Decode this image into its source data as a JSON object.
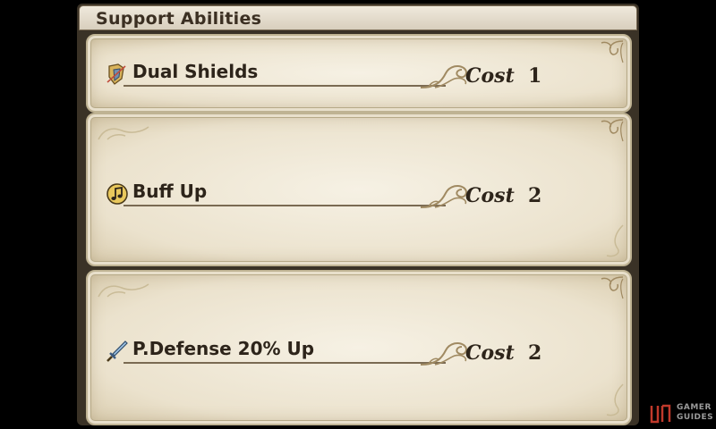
{
  "header": {
    "title": "Support Abilities"
  },
  "abilities": [
    {
      "name": "Dual Shields",
      "icon": "shield-icon",
      "cost_label": "Cost",
      "cost": "1"
    },
    {
      "name": "Buff Up",
      "icon": "music-note-icon",
      "cost_label": "Cost",
      "cost": "2"
    },
    {
      "name": "P.Defense 20% Up",
      "icon": "sword-icon",
      "cost_label": "Cost",
      "cost": "2"
    }
  ],
  "watermark": {
    "line1": "GAMER",
    "line2": "GUIDES"
  },
  "colors": {
    "background": "#000000",
    "panel": "#efe7d4",
    "text": "#2d241a",
    "ornament": "#a08a62"
  }
}
